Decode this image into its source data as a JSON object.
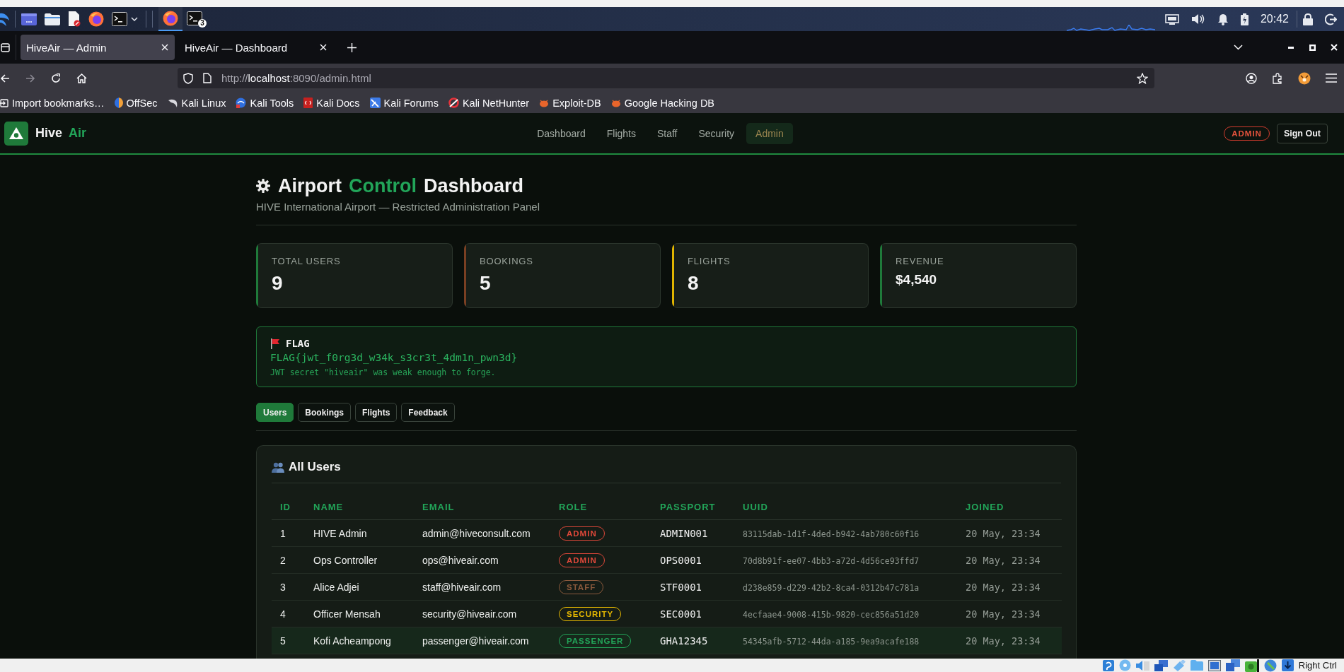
{
  "taskbar": {
    "windows": [
      {
        "kind": "browser",
        "selected": true
      },
      {
        "kind": "terminal",
        "selected": false,
        "badge": "3"
      }
    ],
    "clock": "20:42"
  },
  "browser": {
    "tabs": [
      {
        "title": "HiveAir — Admin",
        "selected": true
      },
      {
        "title": "HiveAir — Dashboard",
        "selected": false
      }
    ],
    "nav_buttons": [
      {
        "kind": "back",
        "disabled": false
      },
      {
        "kind": "forward",
        "disabled": true
      },
      {
        "kind": "reload",
        "disabled": false
      },
      {
        "kind": "home",
        "disabled": false
      }
    ],
    "url": {
      "scheme": "http://",
      "host": "localhost",
      "path": ":8090/admin.html"
    },
    "bookmarks": [
      {
        "label": "Import bookmarks…",
        "kind": "import"
      },
      {
        "label": "OffSec",
        "kind": "offsec"
      },
      {
        "label": "Kali Linux",
        "kind": "dragon"
      },
      {
        "label": "Kali Tools",
        "kind": "tools"
      },
      {
        "label": "Kali Docs",
        "kind": "docs"
      },
      {
        "label": "Kali Forums",
        "kind": "forums"
      },
      {
        "label": "Kali NetHunter",
        "kind": "nethunter"
      },
      {
        "label": "Exploit-DB",
        "kind": "bug"
      },
      {
        "label": "Google Hacking DB",
        "kind": "bug"
      }
    ]
  },
  "app": {
    "brand": {
      "name": "Hive",
      "accent": "Air"
    },
    "nav": [
      {
        "label": "Dashboard",
        "selected": false
      },
      {
        "label": "Flights",
        "selected": false
      },
      {
        "label": "Staff",
        "selected": false
      },
      {
        "label": "Security",
        "selected": false
      },
      {
        "label": "Admin",
        "selected": true
      }
    ],
    "role_badge": "ADMIN",
    "sign_out": "Sign Out"
  },
  "page": {
    "title": {
      "lead": "Airport",
      "accent": "Control",
      "tail": "Dashboard"
    },
    "subtitle": "HIVE International Airport — Restricted Administration Panel",
    "stats": [
      {
        "label": "TOTAL USERS",
        "value": "9",
        "kind": "count",
        "color": "#1f7a3a"
      },
      {
        "label": "BOOKINGS",
        "value": "5",
        "kind": "count",
        "color": "#7a3f22"
      },
      {
        "label": "FLIGHTS",
        "value": "8",
        "kind": "count",
        "color": "#e0b400"
      },
      {
        "label": "REVENUE",
        "value": "$4,540",
        "kind": "amount",
        "color": "#1f7a3a"
      }
    ],
    "flag": {
      "heading": "FLAG",
      "value": "FLAG{jwt_f0rg3d_w34k_s3cr3t_4dm1n_pwn3d}",
      "note": "JWT secret \"hiveair\" was weak enough to forge."
    },
    "tabs": [
      {
        "label": "Users",
        "selected": true
      },
      {
        "label": "Bookings",
        "selected": false
      },
      {
        "label": "Flights",
        "selected": false
      },
      {
        "label": "Feedback",
        "selected": false
      }
    ],
    "users": {
      "heading": "All Users",
      "columns": [
        "ID",
        "NAME",
        "EMAIL",
        "ROLE",
        "PASSPORT",
        "UUID",
        "JOINED"
      ],
      "rows": [
        {
          "id": "1",
          "name": "HIVE Admin",
          "email": "admin@hiveconsult.com",
          "role": {
            "label": "ADMIN",
            "color": "#e0483a"
          },
          "passport": "ADMIN001",
          "uuid": "83115dab-1d1f-4ded-b942-4ab780c60f16",
          "joined": "20 May, 23:34",
          "highlighted": false
        },
        {
          "id": "2",
          "name": "Ops Controller",
          "email": "ops@hiveair.com",
          "role": {
            "label": "ADMIN",
            "color": "#e0483a"
          },
          "passport": "OPS0001",
          "uuid": "70d8b91f-ee07-4bb3-a72d-4d56ce93ffd7",
          "joined": "20 May, 23:34",
          "highlighted": false
        },
        {
          "id": "3",
          "name": "Alice Adjei",
          "email": "staff@hiveair.com",
          "role": {
            "label": "STAFF",
            "color": "#8b5a3c"
          },
          "passport": "STF0001",
          "uuid": "d238e859-d229-42b2-8ca4-0312b47c781a",
          "joined": "20 May, 23:34",
          "highlighted": false
        },
        {
          "id": "4",
          "name": "Officer Mensah",
          "email": "security@hiveair.com",
          "role": {
            "label": "SECURITY",
            "color": "#e6b800"
          },
          "passport": "SEC0001",
          "uuid": "4ecfaae4-9008-415b-9820-cec856a51d20",
          "joined": "20 May, 23:34",
          "highlighted": false
        },
        {
          "id": "5",
          "name": "Kofi Acheampong",
          "email": "passenger@hiveair.com",
          "role": {
            "label": "PASSENGER",
            "color": "#22a559"
          },
          "passport": "GHA12345",
          "uuid": "54345afb-5712-44da-a185-9ea9acafe188",
          "joined": "20 May, 23:34",
          "highlighted": true
        }
      ]
    }
  },
  "vm_status_bar": {
    "host_key": "Right Ctrl"
  }
}
